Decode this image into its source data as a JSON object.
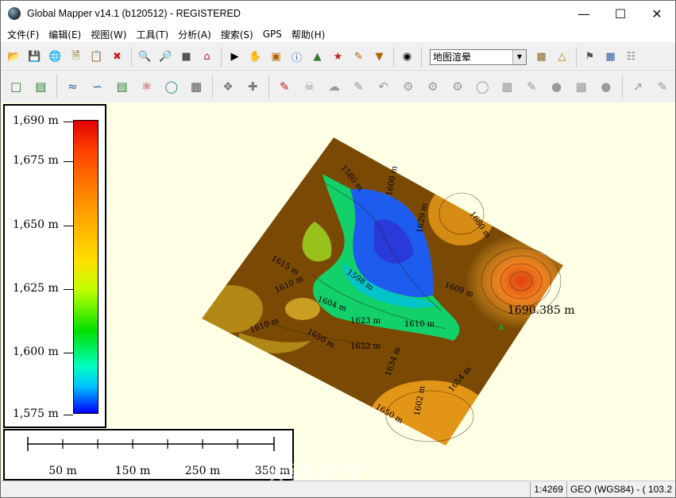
{
  "window": {
    "title": "Global Mapper v14.1 (b120512) - REGISTERED"
  },
  "menu": [
    "文件(F)",
    "编辑(E)",
    "视图(W)",
    "工具(T)",
    "分析(A)",
    "搜索(S)",
    "GPS",
    "帮助(H)"
  ],
  "toolbar": {
    "layer_select": "地图渲晕"
  },
  "legend": {
    "labels": [
      "1,690 m",
      "1,675 m",
      "1,650 m",
      "1,625 m",
      "1,600 m",
      "1,575 m"
    ],
    "color_max": "#e00000",
    "color_min": "#0000ff"
  },
  "scalebar": {
    "labels": [
      "50 m",
      "150 m",
      "250 m",
      "350 m"
    ]
  },
  "map": {
    "labels": [
      "1580 m",
      "1600 m",
      "1629 m",
      "1615 m",
      "1598 m",
      "1610 m",
      "1604 m",
      "1623 m",
      "1610 m",
      "1609 m",
      "1610 m",
      "1652 m",
      "1650 m",
      "1634 m",
      "1650 m",
      "1654 m",
      "1680 m",
      "1602 m"
    ],
    "peak_label": "1690.385 m",
    "colors": {
      "low": "#1e5cf0",
      "mid": "#12d06a",
      "brown": "#7a4a05",
      "high": "#f5a21a"
    }
  },
  "watermark": "大疆社区",
  "status": {
    "scale": "1:4269",
    "projection": "GEO (WGS84) - ( 103.2"
  }
}
